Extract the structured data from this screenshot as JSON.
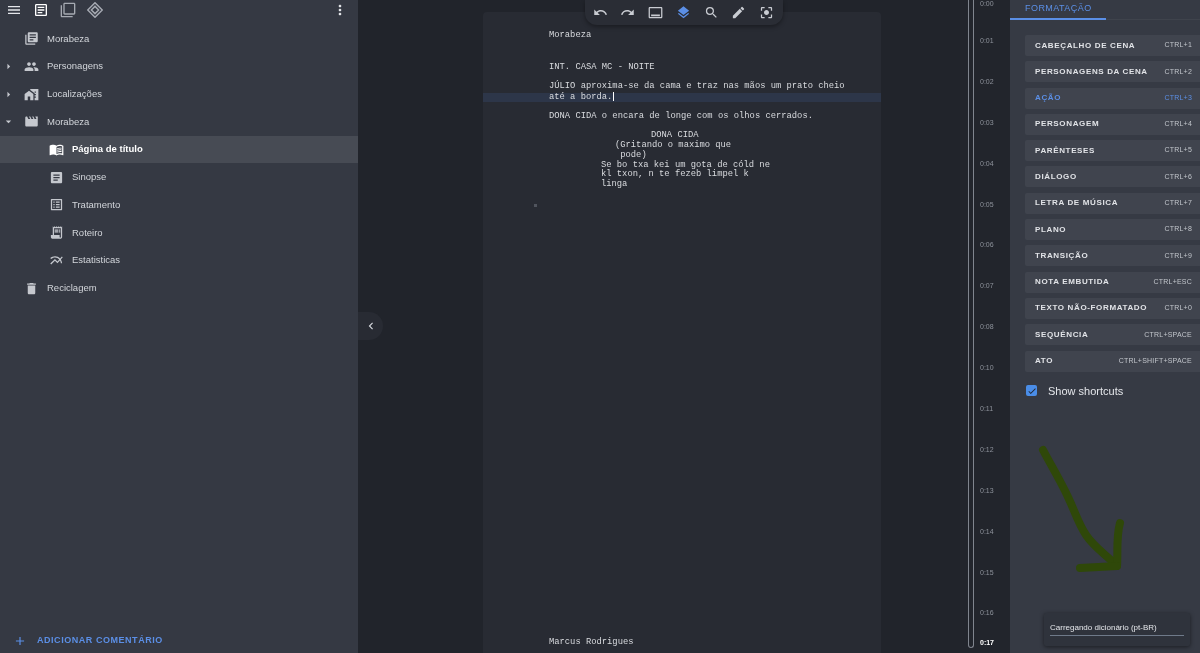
{
  "sidebar": {
    "view_tabs": [
      {
        "selected": true
      },
      {
        "selected": false
      },
      {
        "selected": false
      }
    ],
    "tree": [
      {
        "label": "Morabeza",
        "selected": false
      },
      {
        "label": "Personagens",
        "selected": false,
        "expanded": false
      },
      {
        "label": "Localizações",
        "selected": false,
        "expanded": false
      },
      {
        "label": "Morabeza",
        "selected": false,
        "expanded": true,
        "children": [
          {
            "label": "Página de título",
            "selected": true
          },
          {
            "label": "Sinopse",
            "selected": false
          },
          {
            "label": "Tratamento",
            "selected": false
          },
          {
            "label": "Roteiro",
            "selected": false
          },
          {
            "label": "Estatisticas",
            "selected": false
          }
        ]
      },
      {
        "label": "Reciclagem",
        "selected": false
      }
    ],
    "add_comment": "ADICIONAR COMENTÁRIO"
  },
  "editor": {
    "toolbar": [
      {
        "selected": false
      },
      {
        "selected": false
      },
      {
        "selected": false
      },
      {
        "selected": true
      },
      {
        "selected": false
      },
      {
        "selected": false
      },
      {
        "selected": false
      }
    ],
    "script": [
      {
        "kind": "title",
        "text": "Morabeza",
        "active": false
      },
      {
        "kind": "scene_heading",
        "text": "INT. CASA MC - NOITE",
        "active": false
      },
      {
        "kind": "action",
        "text": "JÚLIO aproxima-se da cama e traz nas mãos um prato cheio até a borda.",
        "active": true
      },
      {
        "kind": "action",
        "text": "DONA CIDA o encara de longe com os olhos cerrados.",
        "active": false
      },
      {
        "kind": "character",
        "text": "DONA CIDA",
        "active": false
      },
      {
        "kind": "parenthetical",
        "text": "(Gritando o maximo que pode)",
        "active": false
      },
      {
        "kind": "dialogue",
        "text": "Se bo txa kei um gota de cóld ne kl txon, n te fezeb limpel k linga",
        "active": false
      }
    ],
    "footer": "Marcus Rodrigues"
  },
  "timeline": {
    "ticks": [
      {
        "label": "0:00",
        "selected": false
      },
      {
        "label": "0:01",
        "selected": false
      },
      {
        "label": "0:02",
        "selected": false
      },
      {
        "label": "0:03",
        "selected": false
      },
      {
        "label": "0:04",
        "selected": false
      },
      {
        "label": "0:05",
        "selected": false
      },
      {
        "label": "0:06",
        "selected": false
      },
      {
        "label": "0:07",
        "selected": false
      },
      {
        "label": "0:08",
        "selected": false
      },
      {
        "label": "0:10",
        "selected": false
      },
      {
        "label": "0:11",
        "selected": false
      },
      {
        "label": "0:12",
        "selected": false
      },
      {
        "label": "0:13",
        "selected": false
      },
      {
        "label": "0:14",
        "selected": false
      },
      {
        "label": "0:15",
        "selected": false
      },
      {
        "label": "0:16",
        "selected": false
      },
      {
        "label": "0:17",
        "selected": true
      }
    ]
  },
  "format_panel": {
    "tabs": [
      {
        "label": "FORMATAÇÃO",
        "selected": true
      }
    ],
    "styles": [
      {
        "label": "CABEÇALHO DE CENA",
        "shortcut": "CTRL+1",
        "selected": false
      },
      {
        "label": "PERSONAGENS DA CENA",
        "shortcut": "CTRL+2",
        "selected": false
      },
      {
        "label": "AÇÃO",
        "shortcut": "CTRL+3",
        "selected": true
      },
      {
        "label": "PERSONAGEM",
        "shortcut": "CTRL+4",
        "selected": false
      },
      {
        "label": "PARÊNTESES",
        "shortcut": "CTRL+5",
        "selected": false
      },
      {
        "label": "DIÁLOGO",
        "shortcut": "CTRL+6",
        "selected": false
      },
      {
        "label": "LETRA DE MÚSICA",
        "shortcut": "CTRL+7",
        "selected": false
      },
      {
        "label": "PLANO",
        "shortcut": "CTRL+8",
        "selected": false
      },
      {
        "label": "TRANSIÇÃO",
        "shortcut": "CTRL+9",
        "selected": false
      },
      {
        "label": "NOTA EMBUTIDA",
        "shortcut": "CTRL+ESC",
        "selected": false
      },
      {
        "label": "TEXTO NÃO-FORMATADO",
        "shortcut": "CTRL+0",
        "selected": false
      },
      {
        "label": "SEQUÊNCIA",
        "shortcut": "CTRL+SPACE",
        "selected": false
      },
      {
        "label": "ATO",
        "shortcut": "CTRL+SHIFT+SPACE",
        "selected": false
      }
    ],
    "show_shortcuts": {
      "label": "Show shortcuts",
      "checked": true
    }
  },
  "snackbar": {
    "message": "Carregando dicionário (pt-BR)",
    "progress": {
      "level": 1
    }
  }
}
